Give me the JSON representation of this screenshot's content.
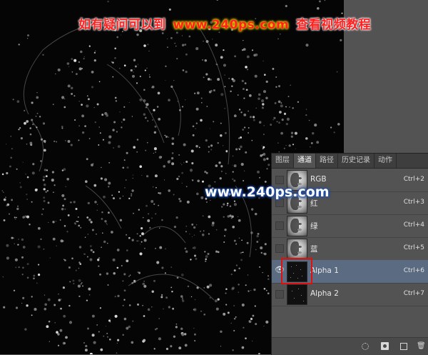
{
  "banner": {
    "part1": "如有疑问可以到",
    "part2": "www.240ps.com",
    "part3": "查看视频教程"
  },
  "watermark": "www.240ps.com",
  "panel": {
    "tabs": [
      "图层",
      "通道",
      "路径",
      "历史记录",
      "动作"
    ],
    "active_tab": "通道",
    "channels": [
      {
        "label": "RGB",
        "shortcut": "Ctrl+2",
        "visible": false,
        "thumb": "face-icon"
      },
      {
        "label": "红",
        "shortcut": "Ctrl+3",
        "visible": false,
        "thumb": "face-icon"
      },
      {
        "label": "绿",
        "shortcut": "Ctrl+4",
        "visible": false,
        "thumb": "face-icon"
      },
      {
        "label": "蓝",
        "shortcut": "Ctrl+5",
        "visible": false,
        "thumb": "face-icon"
      },
      {
        "label": "Alpha 1",
        "shortcut": "Ctrl+6",
        "visible": true,
        "selected": true,
        "thumb": "dark-noise-icon"
      },
      {
        "label": "Alpha 2",
        "shortcut": "Ctrl+7",
        "visible": false,
        "thumb": "dark-noise-icon"
      }
    ],
    "bottom_icons": [
      "load-selection-icon",
      "save-selection-icon",
      "new-channel-icon",
      "delete-channel-icon"
    ]
  },
  "colors": {
    "canvas_bg": "#050505",
    "panel_bg": "#535353",
    "selected_row": "#5b6c82",
    "highlight_box": "#e01010"
  }
}
